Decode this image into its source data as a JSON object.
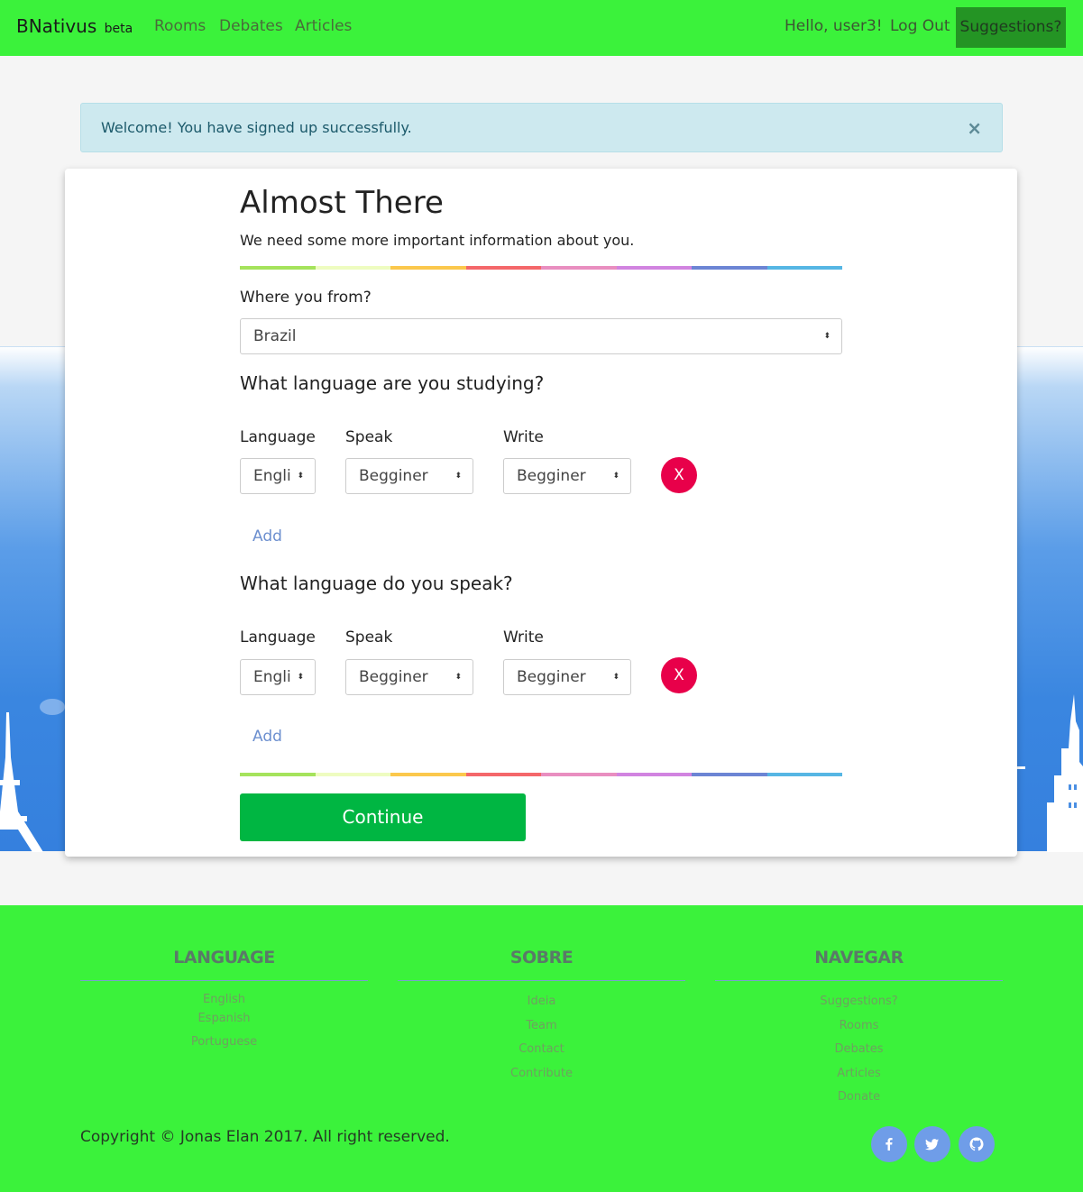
{
  "navbar": {
    "brand": "BNativus",
    "brand_tag": "beta",
    "links": [
      "Rooms",
      "Debates",
      "Articles"
    ],
    "greeting": "Hello, user3!",
    "logout": "Log Out",
    "suggestions": "Suggestions?",
    "colors": {
      "bar": "#3bf23b",
      "suggest_bg": "#249424"
    }
  },
  "alert": {
    "message": "Welcome! You have signed up successfully.",
    "close": "×"
  },
  "form": {
    "title": "Almost There",
    "subtitle": "We need some more important information about you.",
    "rainbow_colors": [
      "#a5e35c",
      "#eefcc0",
      "#fbc84c",
      "#f4676a",
      "#e98ec0",
      "#d184e0",
      "#6c85d4",
      "#56b6e4"
    ],
    "country": {
      "label": "Where you from?",
      "value": "Brazil"
    },
    "studying": {
      "heading": "What language are you studying?",
      "col_language": "Language",
      "col_speak": "Speak",
      "col_write": "Write",
      "language_value": "Engli",
      "speak_value": "Begginer",
      "write_value": "Begginer",
      "remove": "X",
      "add": "Add"
    },
    "speaking": {
      "heading": "What language do you speak?",
      "col_language": "Language",
      "col_speak": "Speak",
      "col_write": "Write",
      "language_value": "Engli",
      "speak_value": "Begginer",
      "write_value": "Begginer",
      "remove": "X",
      "add": "Add"
    },
    "continue": "Continue"
  },
  "footer": {
    "columns": [
      {
        "heading": "LANGUAGE",
        "items": [
          "English",
          "Espanish",
          "Portuguese"
        ]
      },
      {
        "heading": "SOBRE",
        "items": [
          "Ideia",
          "Team",
          "Contact",
          "Contribute"
        ]
      },
      {
        "heading": "NAVEGAR",
        "items": [
          "Suggestions?",
          "Rooms",
          "Debates",
          "Articles",
          "Donate"
        ]
      }
    ],
    "copyright": "Copyright © Jonas Elan 2017. All right reserved.",
    "social_icons": [
      "facebook-icon",
      "twitter-icon",
      "github-icon"
    ]
  }
}
